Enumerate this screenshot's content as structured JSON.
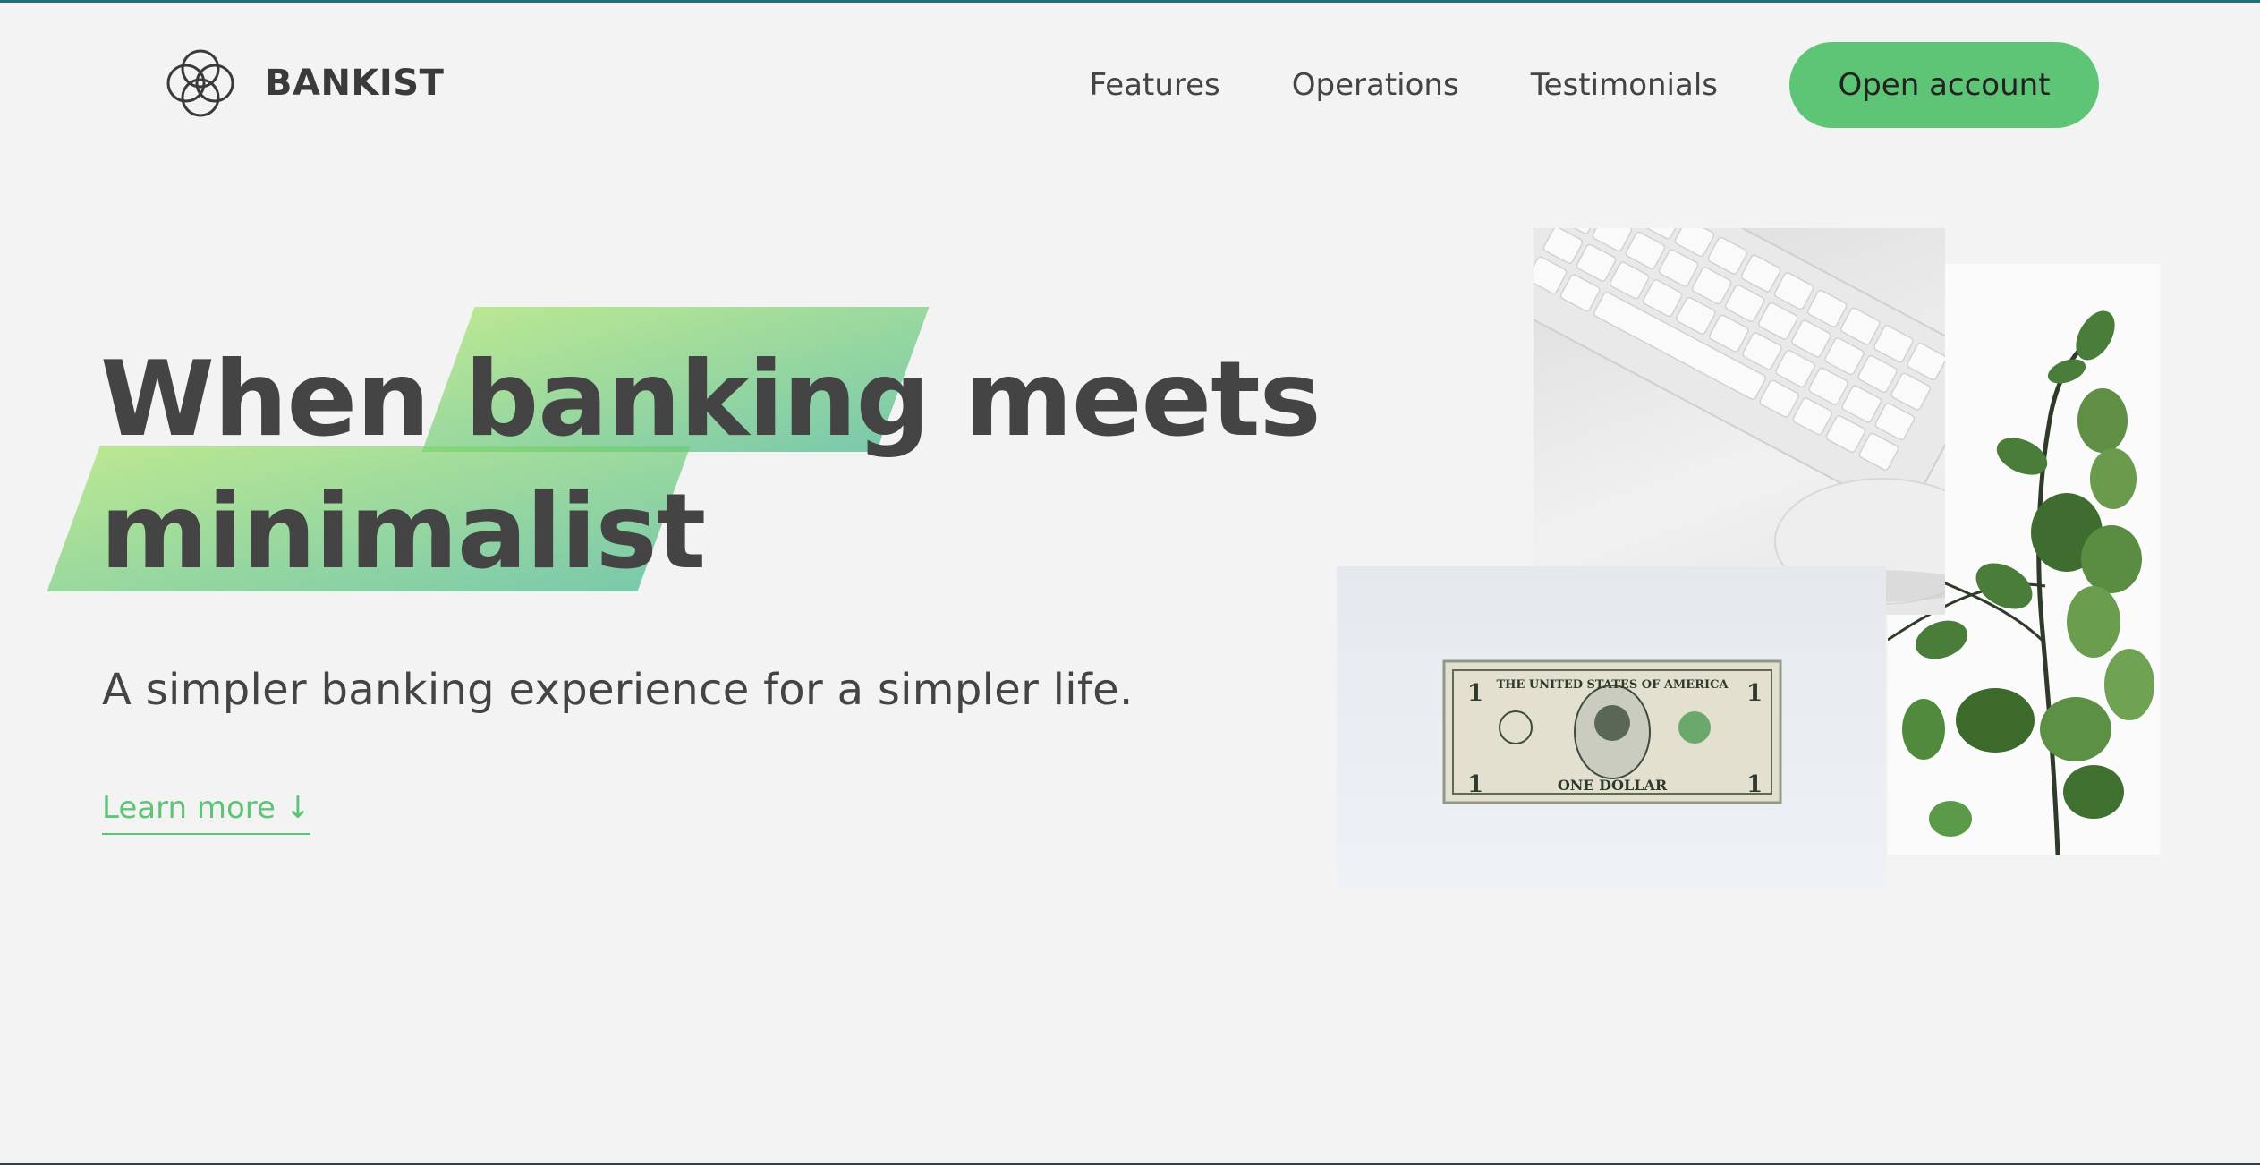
{
  "brand": {
    "name": "BANKIST",
    "accent": "#5ec576",
    "text_color": "#444444",
    "background": "#f3f3f3"
  },
  "nav": {
    "links": [
      {
        "label": "Features"
      },
      {
        "label": "Operations"
      },
      {
        "label": "Testimonials"
      }
    ],
    "cta_label": "Open account"
  },
  "hero": {
    "title_parts": [
      "When",
      "banking",
      "meets",
      "minimalist"
    ],
    "highlighted": [
      "banking",
      "minimalist"
    ],
    "subtitle": "A simpler banking experience for a simpler life.",
    "learn_more": "Learn more ↓"
  },
  "illustration": {
    "images": [
      "keyboard-and-mouse",
      "eucalyptus-plant",
      "one-dollar-bill"
    ],
    "dollar_bill_text": "THE UNITED STATES OF AMERICA",
    "dollar_bill_denomination": "ONE DOLLAR"
  }
}
